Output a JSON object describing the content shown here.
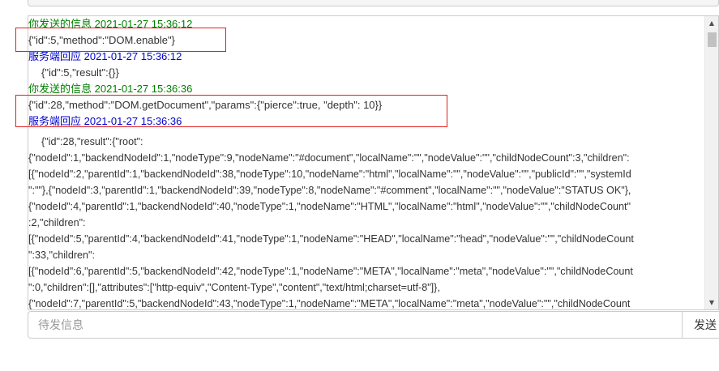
{
  "log": {
    "entries": [
      {
        "header": "你发送的信息",
        "time": "2021-01-27 15:36:12",
        "body": "{\"id\":5,\"method\":\"DOM.enable\"}"
      },
      {
        "header": "服务端回应",
        "time": "2021-01-27 15:36:12",
        "body": "{\"id\":5,\"result\":{}}"
      },
      {
        "header": "你发送的信息",
        "time": "2021-01-27 15:36:36",
        "body": "{\"id\":28,\"method\":\"DOM.getDocument\",\"params\":{\"pierce\":true, \"depth\": 10}}"
      },
      {
        "header": "服务端回应",
        "time": "2021-01-27 15:36:36"
      }
    ],
    "response_lines": [
      "{\"id\":28,\"result\":{\"root\":",
      "{\"nodeId\":1,\"backendNodeId\":1,\"nodeType\":9,\"nodeName\":\"#document\",\"localName\":\"\",\"nodeValue\":\"\",\"childNodeCount\":3,\"children\":",
      "[{\"nodeId\":2,\"parentId\":1,\"backendNodeId\":38,\"nodeType\":10,\"nodeName\":\"html\",\"localName\":\"\",\"nodeValue\":\"\",\"publicId\":\"\",\"systemId",
      "\":\"\"},{\"nodeId\":3,\"parentId\":1,\"backendNodeId\":39,\"nodeType\":8,\"nodeName\":\"#comment\",\"localName\":\"\",\"nodeValue\":\"STATUS OK\"},",
      "{\"nodeId\":4,\"parentId\":1,\"backendNodeId\":40,\"nodeType\":1,\"nodeName\":\"HTML\",\"localName\":\"html\",\"nodeValue\":\"\",\"childNodeCount\"",
      ":2,\"children\":",
      "[{\"nodeId\":5,\"parentId\":4,\"backendNodeId\":41,\"nodeType\":1,\"nodeName\":\"HEAD\",\"localName\":\"head\",\"nodeValue\":\"\",\"childNodeCount",
      "\":33,\"children\":",
      "[{\"nodeId\":6,\"parentId\":5,\"backendNodeId\":42,\"nodeType\":1,\"nodeName\":\"META\",\"localName\":\"meta\",\"nodeValue\":\"\",\"childNodeCount",
      "\":0,\"children\":[],\"attributes\":[\"http-equiv\",\"Content-Type\",\"content\",\"text/html;charset=utf-8\"]},",
      "{\"nodeId\":7,\"parentId\":5,\"backendNodeId\":43,\"nodeType\":1,\"nodeName\":\"META\",\"localName\":\"meta\",\"nodeValue\":\"\",\"childNodeCount"
    ]
  },
  "input": {
    "placeholder": "待发信息",
    "value": ""
  },
  "send_button": {
    "label": "发送"
  },
  "colors": {
    "sent_header": "#008000",
    "received_header": "#0000cd",
    "highlight_border": "#e02020"
  },
  "icons": {
    "scroll_up": "scroll-up-arrow-icon",
    "scroll_down": "scroll-down-arrow-icon"
  }
}
